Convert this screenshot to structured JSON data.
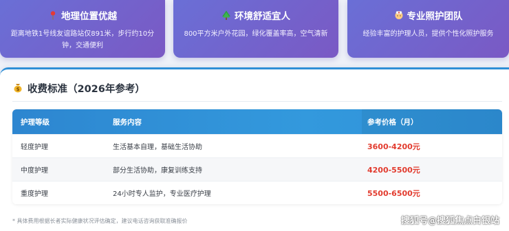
{
  "features": [
    {
      "icon": "pin-icon",
      "title": "地理位置优越",
      "desc": "距离地铁1号线友谊路站仅891米，步行约10分钟，交通便利"
    },
    {
      "icon": "tree-icon",
      "title": "环境舒适宜人",
      "desc": "800平方米户外花园，绿化覆盖率高，空气清新"
    },
    {
      "icon": "nurse-icon",
      "title": "专业照护团队",
      "desc": "经验丰富的护理人员，提供个性化照护服务"
    }
  ],
  "pricing": {
    "icon": "money-bag-icon",
    "title": "收费标准（2026年参考）",
    "headers": {
      "level": "护理等级",
      "service": "服务内容",
      "price": "参考价格（月）"
    },
    "rows": [
      {
        "level": "轻度护理",
        "service": "生活基本自理，基础生活协助",
        "price": "3600-4200元"
      },
      {
        "level": "中度护理",
        "service": "部分生活协助，康复训练支持",
        "price": "4200-5500元"
      },
      {
        "level": "重度护理",
        "service": "24小时专人监护，专业医疗护理",
        "price": "5500-6500元"
      }
    ],
    "note": "* 具体费用根据长者实际健康状况评估确定，建议电话咨询获取准确报价"
  },
  "watermark": "搜狐号@搜狐焦点白银站",
  "colors": {
    "card_gradient_start": "#6a6fd6",
    "card_gradient_end": "#7a59c4",
    "header_blue": "#2d86d0",
    "price_red": "#e23b2e"
  }
}
